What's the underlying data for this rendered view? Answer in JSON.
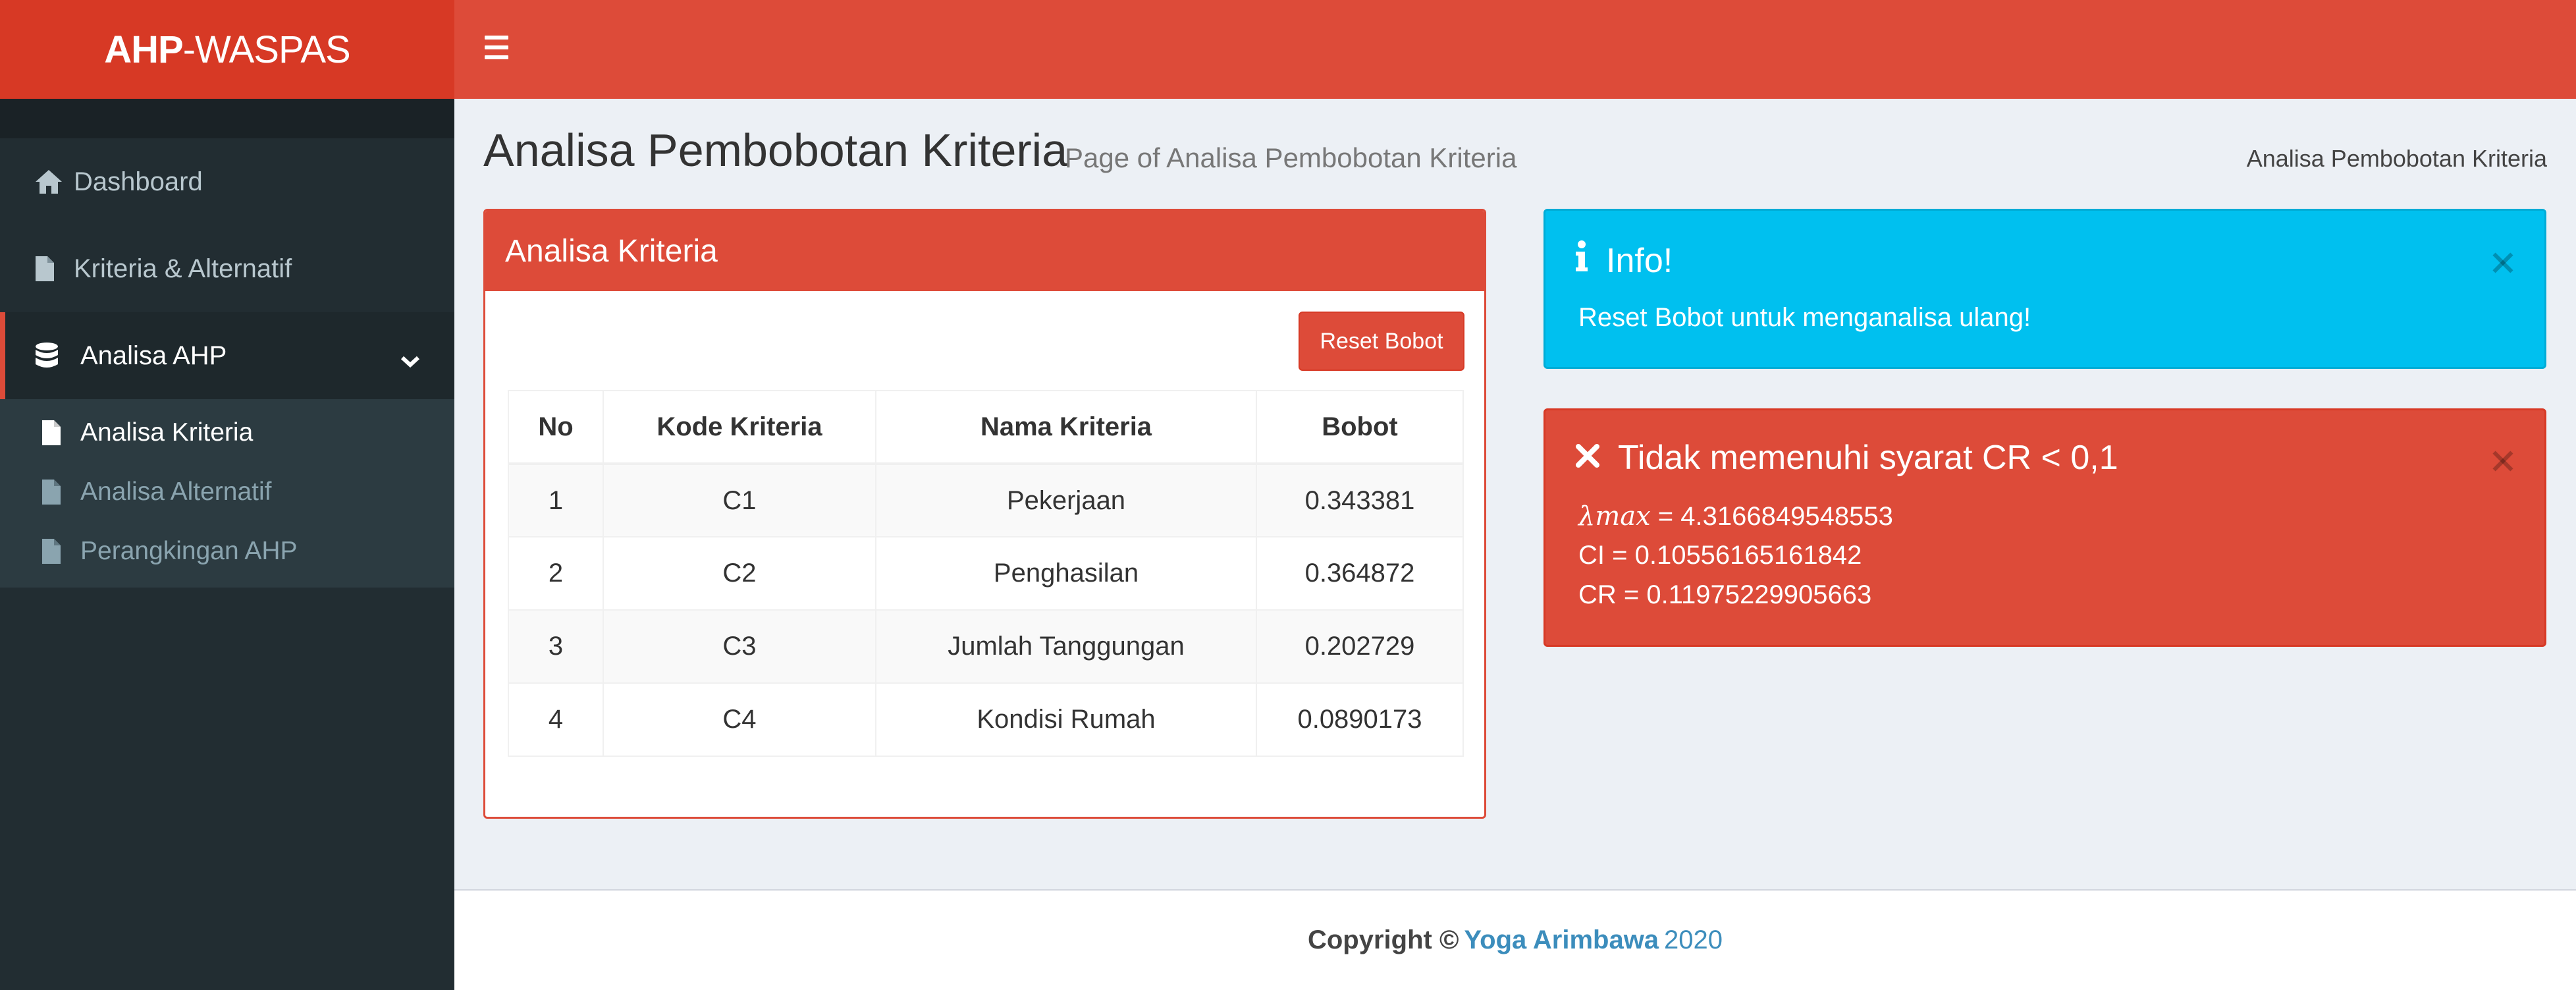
{
  "header": {
    "logo_bold": "AHP",
    "logo_rest": "-WASPAS",
    "menu_icon": "hamburger-icon"
  },
  "sidebar": {
    "items": [
      {
        "label": "Dashboard",
        "icon": "home-icon"
      },
      {
        "label": "Kriteria & Alternatif",
        "icon": "file-icon"
      },
      {
        "label": "Analisa AHP",
        "icon": "database-icon",
        "active": true
      }
    ],
    "submenu": [
      {
        "label": "Analisa Kriteria",
        "icon": "file-icon",
        "current": true
      },
      {
        "label": "Analisa Alternatif",
        "icon": "file-icon"
      },
      {
        "label": "Perangkingan AHP",
        "icon": "file-icon"
      }
    ]
  },
  "page": {
    "title": "Analisa Pembobotan Kriteria",
    "subtitle": "Page of Analisa Pembobotan Kriteria",
    "breadcrumb": "Analisa Pembobotan Kriteria"
  },
  "panel": {
    "title": "Analisa Kriteria",
    "reset_label": "Reset Bobot",
    "columns": [
      "No",
      "Kode Kriteria",
      "Nama Kriteria",
      "Bobot"
    ],
    "rows": [
      [
        "1",
        "C1",
        "Pekerjaan",
        "0.343381"
      ],
      [
        "2",
        "C2",
        "Penghasilan",
        "0.364872"
      ],
      [
        "3",
        "C3",
        "Jumlah Tanggungan",
        "0.202729"
      ],
      [
        "4",
        "C4",
        "Kondisi Rumah",
        "0.0890173"
      ]
    ]
  },
  "info": {
    "title": "Info!",
    "message": "Reset Bobot untuk menganalisa ulang!",
    "color": "#00c0ef"
  },
  "alert": {
    "title": "Tidak memenuhi syarat CR < 0,1",
    "lambda_label": "λmax",
    "lambda_value": " = 4.3166849548553",
    "ci": "CI = 0.10556165161842",
    "cr": "CR = 0.11975229905663",
    "color": "#dd4b39"
  },
  "footer": {
    "copyright": "Copyright ©",
    "author": "Yoga Arimbawa",
    "year": "2020"
  }
}
